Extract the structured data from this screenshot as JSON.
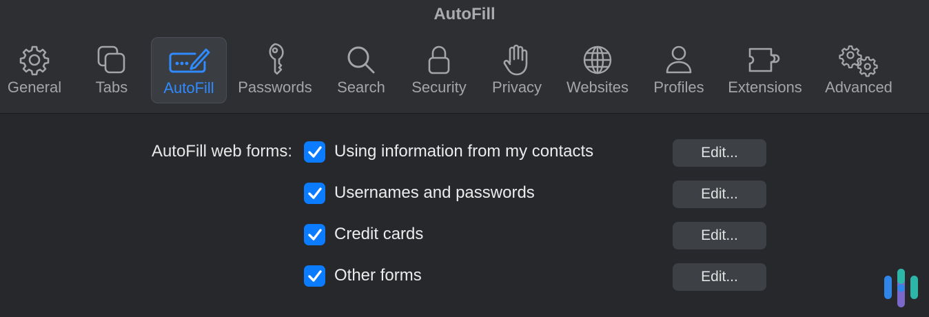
{
  "window": {
    "title": "AutoFill"
  },
  "tabs": [
    {
      "label": "General",
      "icon": "gear-icon"
    },
    {
      "label": "Tabs",
      "icon": "tabs-icon"
    },
    {
      "label": "AutoFill",
      "icon": "autofill-icon",
      "selected": true
    },
    {
      "label": "Passwords",
      "icon": "key-icon"
    },
    {
      "label": "Search",
      "icon": "magnifier-icon"
    },
    {
      "label": "Security",
      "icon": "lock-icon"
    },
    {
      "label": "Privacy",
      "icon": "hand-icon"
    },
    {
      "label": "Websites",
      "icon": "globe-icon"
    },
    {
      "label": "Profiles",
      "icon": "person-icon"
    },
    {
      "label": "Extensions",
      "icon": "puzzle-icon"
    },
    {
      "label": "Advanced",
      "icon": "gears-icon"
    }
  ],
  "autofill": {
    "label": "AutoFill web forms:",
    "options": [
      {
        "text": "Using information from my contacts",
        "checked": true,
        "edit_label": "Edit..."
      },
      {
        "text": "Usernames and passwords",
        "checked": true,
        "edit_label": "Edit..."
      },
      {
        "text": "Credit cards",
        "checked": true,
        "edit_label": "Edit..."
      },
      {
        "text": "Other forms",
        "checked": true,
        "edit_label": "Edit..."
      }
    ]
  },
  "colors": {
    "accent": "#0b7cff",
    "selected_tab_text": "#2f8bff",
    "background": "#26282c",
    "toolbar": "#2d2f33"
  }
}
